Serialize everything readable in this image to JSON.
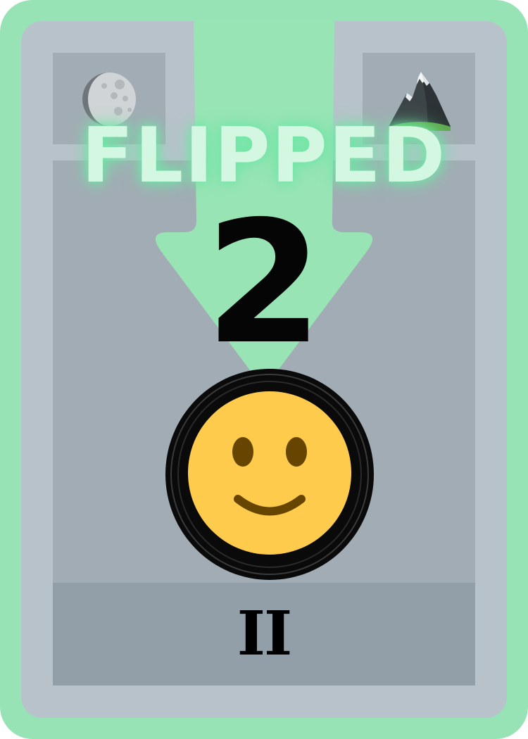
{
  "card": {
    "status_label": "FLIPPED",
    "count": "2",
    "numeral": "II",
    "icons": {
      "top_left": "moon-icon",
      "top_right": "mountain-icon",
      "center": "smiley-face-icon"
    }
  },
  "colors": {
    "border": "#98e3b5",
    "card_face": "#b8c2ca",
    "panel": "#a2acb4",
    "bottom_panel": "#939fa8",
    "arrow": "#99e4b5",
    "flipped_text": "#d4f7e2",
    "flipped_glow": "#6fe6a6",
    "count_text": "#050505",
    "smiley": "#ffcb4c",
    "smiley_features": "#664500"
  }
}
